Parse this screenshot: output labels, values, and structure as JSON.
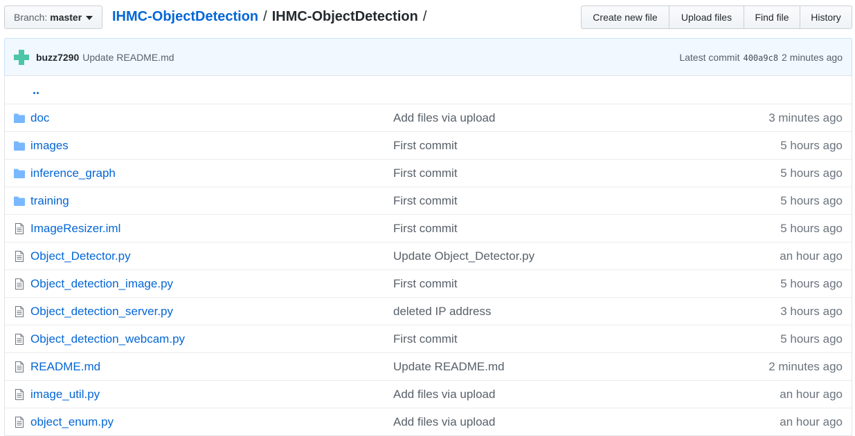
{
  "branch": {
    "label": "Branch:",
    "value": "master"
  },
  "breadcrumb": {
    "repo": "IHMC-ObjectDetection",
    "separator": "/",
    "folder": "IHMC-ObjectDetection",
    "trailing": "/"
  },
  "actions": {
    "create_new_file": "Create new file",
    "upload_files": "Upload files",
    "find_file": "Find file",
    "history": "History"
  },
  "commit": {
    "author": "buzz7290",
    "message": "Update README.md",
    "latest_label": "Latest commit",
    "sha": "400a9c8",
    "time": "2 minutes ago"
  },
  "up_link": "..",
  "files": [
    {
      "type": "dir",
      "icon": "folder-icon",
      "name": "doc",
      "message": "Add files via upload",
      "age": "3 minutes ago"
    },
    {
      "type": "dir",
      "icon": "folder-icon",
      "name": "images",
      "message": "First commit",
      "age": "5 hours ago"
    },
    {
      "type": "dir",
      "icon": "folder-icon",
      "name": "inference_graph",
      "message": "First commit",
      "age": "5 hours ago"
    },
    {
      "type": "dir",
      "icon": "folder-icon",
      "name": "training",
      "message": "First commit",
      "age": "5 hours ago"
    },
    {
      "type": "file",
      "icon": "file-icon",
      "name": "ImageResizer.iml",
      "message": "First commit",
      "age": "5 hours ago"
    },
    {
      "type": "file",
      "icon": "file-icon",
      "name": "Object_Detector.py",
      "message": "Update Object_Detector.py",
      "age": "an hour ago"
    },
    {
      "type": "file",
      "icon": "file-icon",
      "name": "Object_detection_image.py",
      "message": "First commit",
      "age": "5 hours ago"
    },
    {
      "type": "file",
      "icon": "file-icon",
      "name": "Object_detection_server.py",
      "message": "deleted IP address",
      "age": "3 hours ago"
    },
    {
      "type": "file",
      "icon": "file-icon",
      "name": "Object_detection_webcam.py",
      "message": "First commit",
      "age": "5 hours ago"
    },
    {
      "type": "file",
      "icon": "file-icon",
      "name": "README.md",
      "message": "Update README.md",
      "age": "2 minutes ago"
    },
    {
      "type": "file",
      "icon": "file-icon",
      "name": "image_util.py",
      "message": "Add files via upload",
      "age": "an hour ago"
    },
    {
      "type": "file",
      "icon": "file-icon",
      "name": "object_enum.py",
      "message": "Add files via upload",
      "age": "an hour ago"
    }
  ],
  "colors": {
    "link": "#0366d6",
    "folder_icon": "#79b8ff",
    "commit_bg": "#f1f8ff",
    "avatar": "#4dc6a8"
  }
}
